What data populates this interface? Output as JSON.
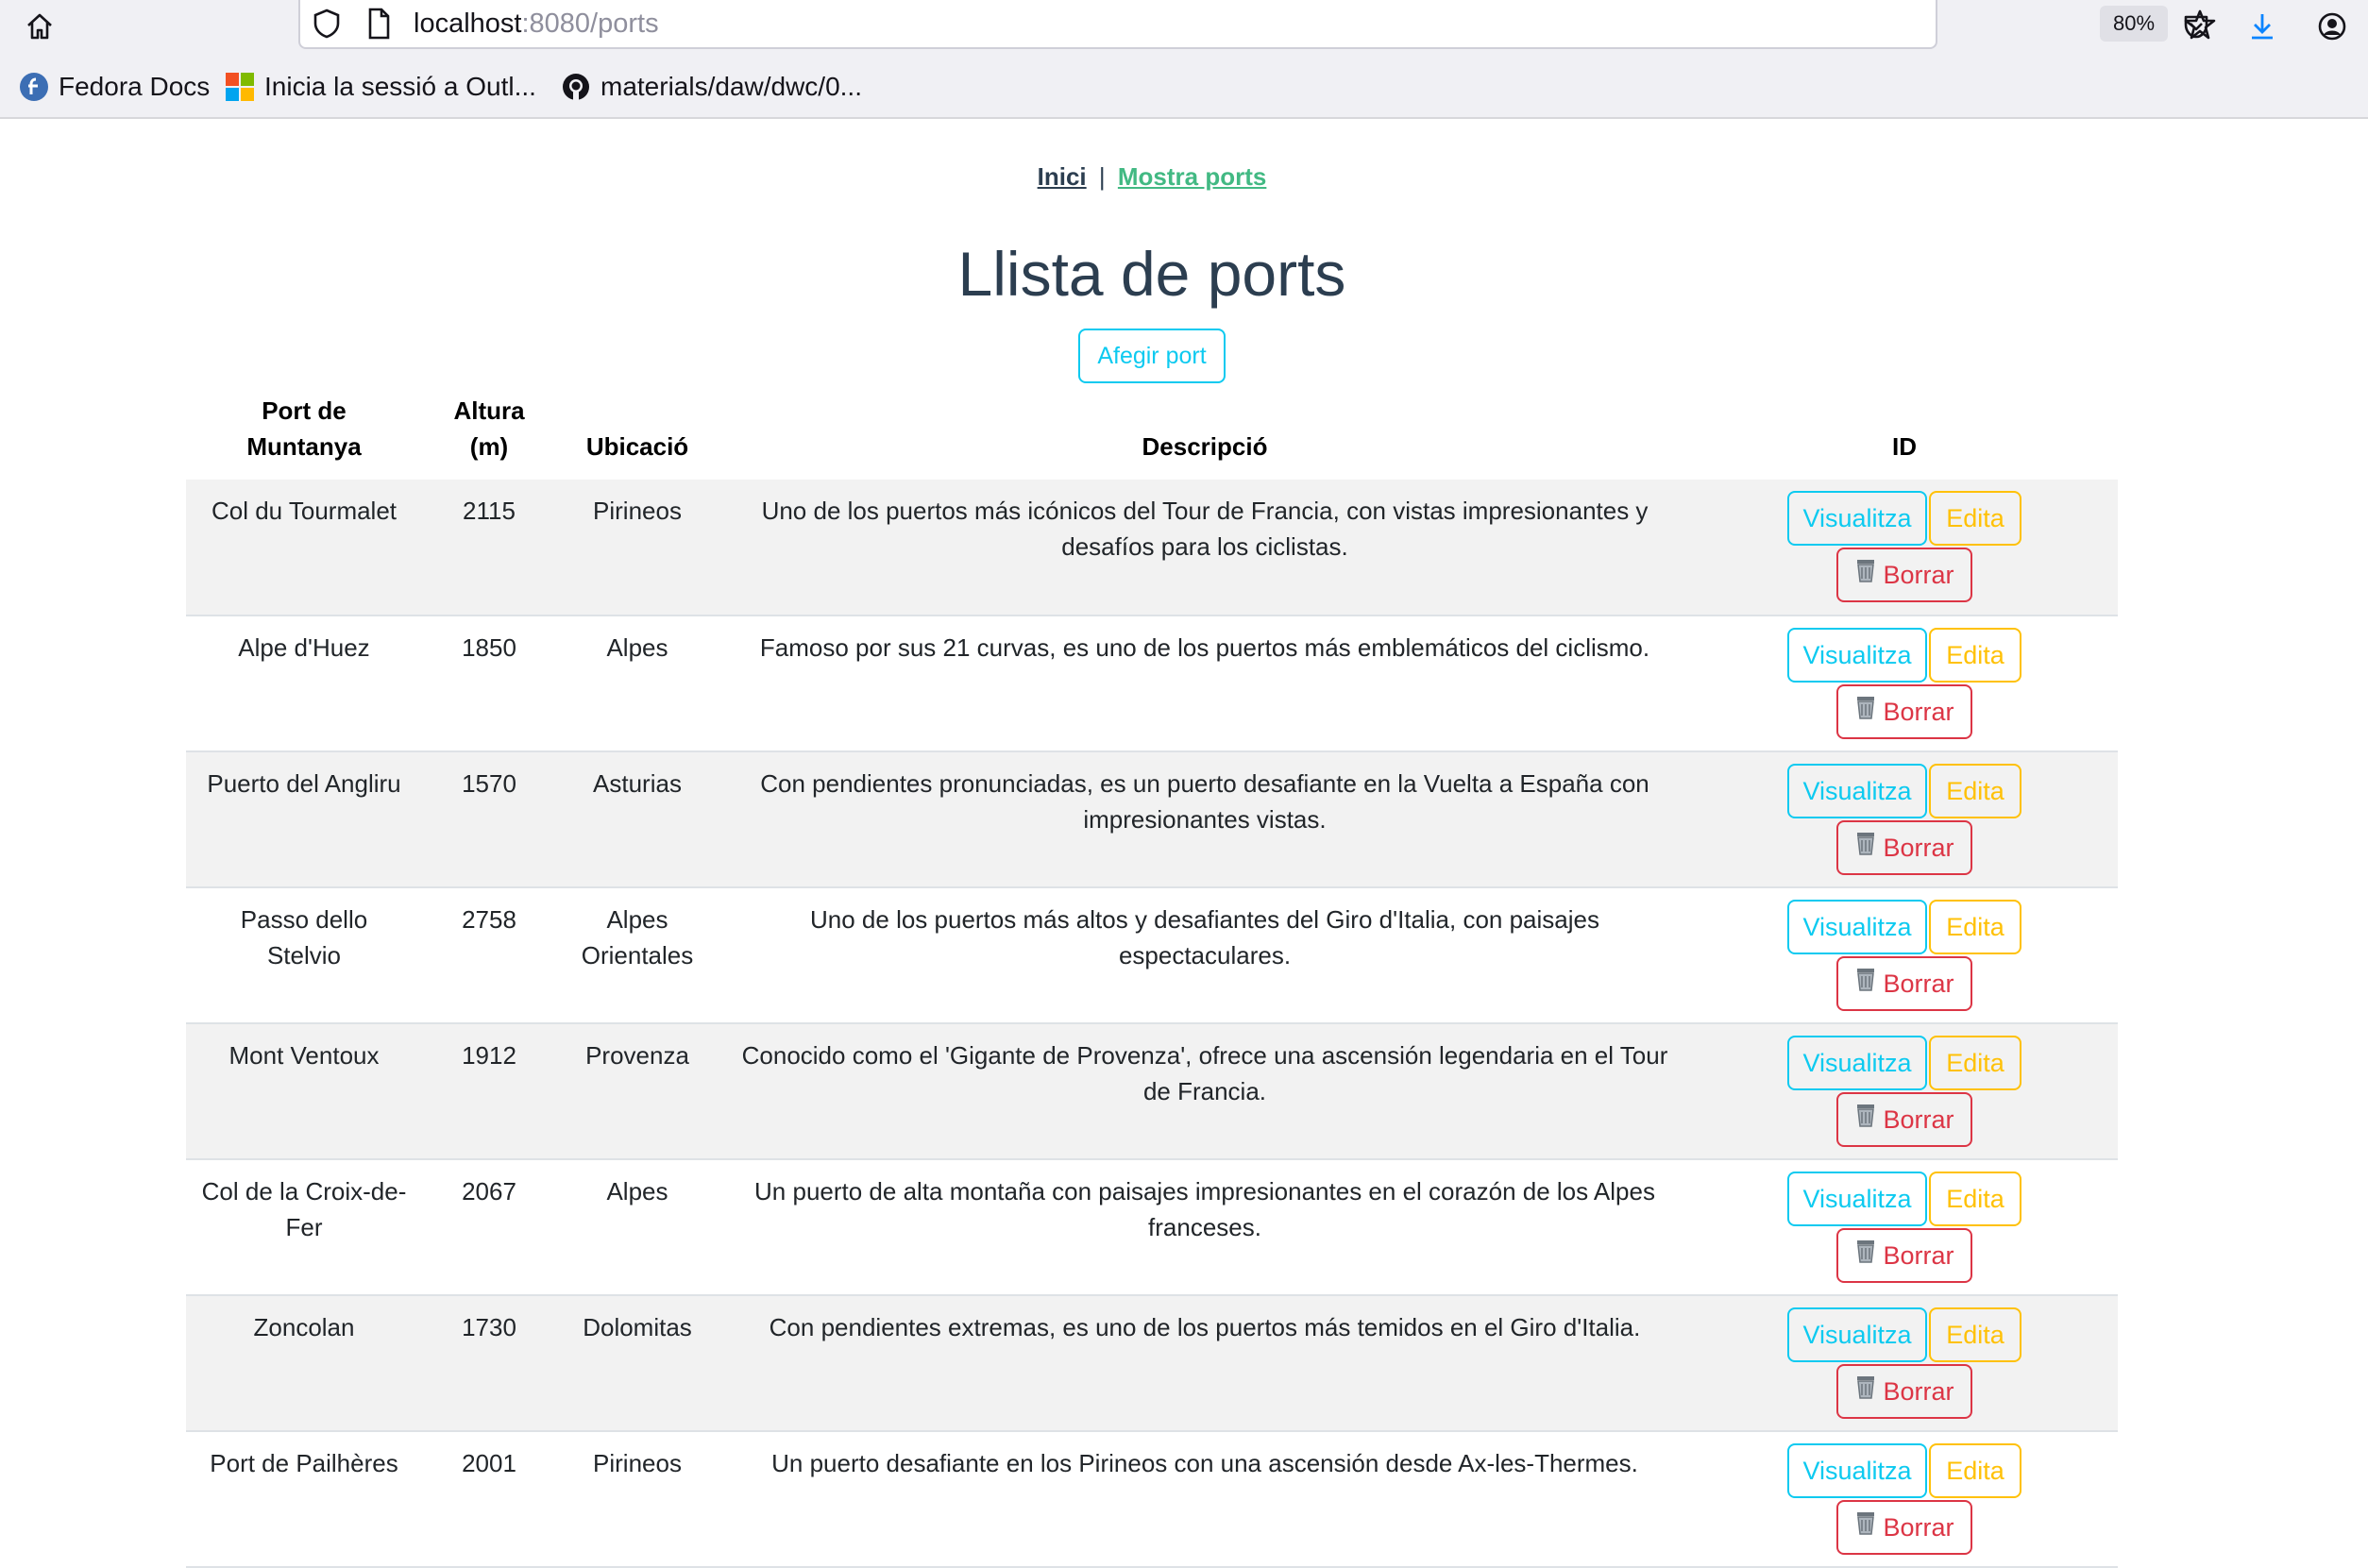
{
  "browser": {
    "url_host": "localhost",
    "url_rest": ":8080/ports",
    "zoom": "80%",
    "bookmarks": [
      {
        "label": "Fedora Docs",
        "icon": "fedora-icon"
      },
      {
        "label": "Inicia la sessió a Outl...",
        "icon": "microsoft-icon"
      },
      {
        "label": "materials/daw/dwc/0...",
        "icon": "github-icon"
      }
    ]
  },
  "nav": {
    "home": "Inici",
    "separator": "|",
    "ports": "Mostra ports"
  },
  "page": {
    "title": "Llista de ports",
    "add_button": "Afegir port"
  },
  "table": {
    "headers": [
      "Port de Muntanya",
      "Altura (m)",
      "Ubicació",
      "Descripció",
      "ID"
    ],
    "actions": {
      "view": "Visualitza",
      "edit": "Edita",
      "delete": "Borrar"
    },
    "rows": [
      {
        "name": "Col du Tourmalet",
        "altura": "2115",
        "ubicacio": "Pirineos",
        "descripcio": "Uno de los puertos más icónicos del Tour de Francia, con vistas impresionantes y desafíos para los ciclistas."
      },
      {
        "name": "Alpe d'Huez",
        "altura": "1850",
        "ubicacio": "Alpes",
        "descripcio": "Famoso por sus 21 curvas, es uno de los puertos más emblemáticos del ciclismo."
      },
      {
        "name": "Puerto del Angliru",
        "altura": "1570",
        "ubicacio": "Asturias",
        "descripcio": "Con pendientes pronunciadas, es un puerto desafiante en la Vuelta a España con impresionantes vistas."
      },
      {
        "name": "Passo dello Stelvio",
        "altura": "2758",
        "ubicacio": "Alpes Orientales",
        "descripcio": "Uno de los puertos más altos y desafiantes del Giro d'Italia, con paisajes espectaculares."
      },
      {
        "name": "Mont Ventoux",
        "altura": "1912",
        "ubicacio": "Provenza",
        "descripcio": "Conocido como el 'Gigante de Provenza', ofrece una ascensión legendaria en el Tour de Francia."
      },
      {
        "name": "Col de la Croix-de-Fer",
        "altura": "2067",
        "ubicacio": "Alpes",
        "descripcio": "Un puerto de alta montaña con paisajes impresionantes en el corazón de los Alpes franceses."
      },
      {
        "name": "Zoncolan",
        "altura": "1730",
        "ubicacio": "Dolomitas",
        "descripcio": "Con pendientes extremas, es uno de los puertos más temidos en el Giro d'Italia."
      },
      {
        "name": "Port de Pailhères",
        "altura": "2001",
        "ubicacio": "Pirineos",
        "descripcio": "Un puerto desafiante en los Pirineos con una ascensión desde Ax-les-Thermes."
      }
    ]
  }
}
